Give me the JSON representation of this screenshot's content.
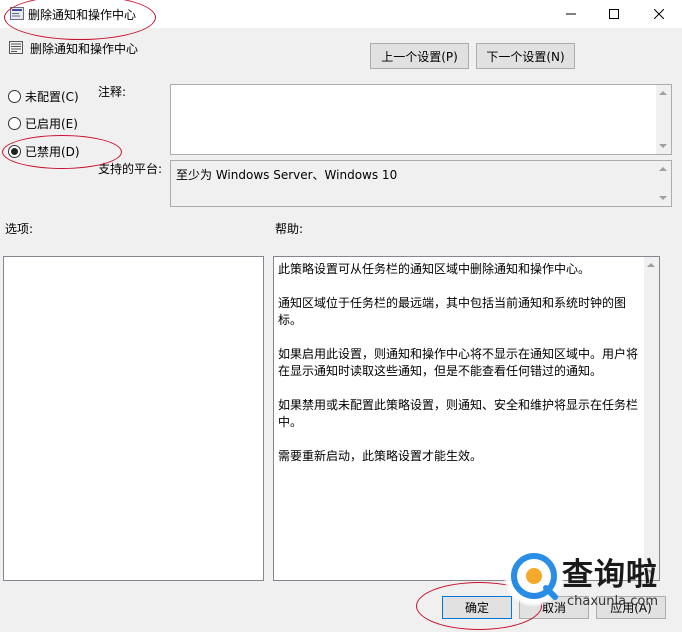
{
  "window": {
    "title": "删除通知和操作中心",
    "controls": {
      "minimize": "minimize-icon",
      "maximize": "maximize-icon",
      "close": "close-icon"
    }
  },
  "header": {
    "policy_name": "删除通知和操作中心",
    "prev_button": "上一个设置(P)",
    "next_button": "下一个设置(N)"
  },
  "state": {
    "options": [
      {
        "label": "未配置(C)",
        "checked": false
      },
      {
        "label": "已启用(E)",
        "checked": false
      },
      {
        "label": "已禁用(D)",
        "checked": true
      }
    ]
  },
  "comment": {
    "label": "注释:",
    "value": ""
  },
  "platform": {
    "label": "支持的平台:",
    "value": "至少为 Windows Server、Windows 10"
  },
  "options_section": {
    "label": "选项:"
  },
  "help_section": {
    "label": "帮助:",
    "paragraphs": [
      "此策略设置可从任务栏的通知区域中删除通知和操作中心。",
      "通知区域位于任务栏的最远端，其中包括当前通知和系统时钟的图标。",
      "如果启用此设置，则通知和操作中心将不显示在通知区域中。用户将在显示通知时读取这些通知，但是不能查看任何错过的通知。",
      "如果禁用或未配置此策略设置，则通知、安全和维护将显示在任务栏中。",
      "需要重新启动，此策略设置才能生效。"
    ]
  },
  "footer": {
    "ok_button": "确定",
    "cancel_button": "取消",
    "apply_button": "应用(A)"
  },
  "watermark": {
    "brand": "查询啦",
    "url": "chaxunla.com"
  },
  "colors": {
    "annotation": "#c8102e",
    "ok_border": "#0078d7",
    "watermark_accent": "#1e88e5",
    "watermark_orange": "#f5a623"
  }
}
